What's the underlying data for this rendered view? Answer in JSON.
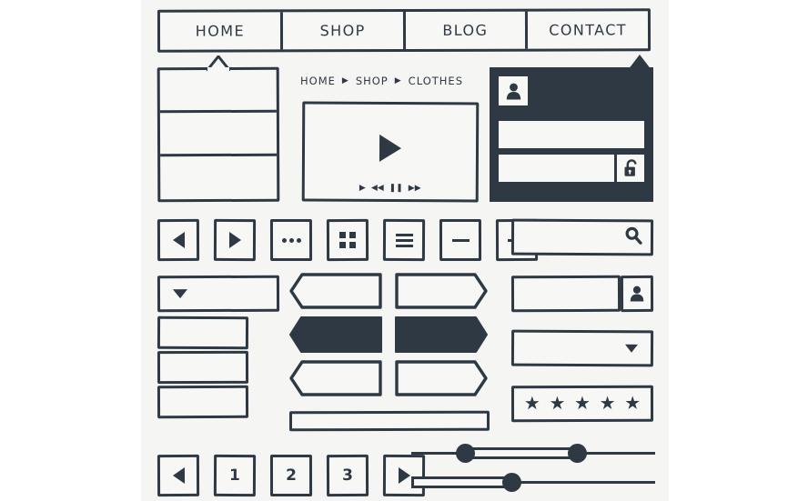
{
  "meta": {
    "title": "Hand-drawn UI Wireframe Element Kit",
    "colors": {
      "ink": "#2f3943",
      "paper": "#f7f7f6",
      "canvas": "#f5f5f4",
      "page": "#ffffff"
    }
  },
  "navbar": {
    "items": [
      {
        "label": "HOME"
      },
      {
        "label": "SHOP"
      },
      {
        "label": "BLOG"
      },
      {
        "label": "CONTACT"
      }
    ]
  },
  "tooltip_panel": {
    "name": "tooltip-accordion",
    "rows": [
      "",
      "",
      ""
    ],
    "notch_icon": "caret-up-notch"
  },
  "breadcrumb": {
    "items": [
      "HOME",
      "SHOP",
      "CLOTHES"
    ],
    "separator": "▶"
  },
  "video_player": {
    "play_icon": "play-triangle-icon",
    "controls": [
      {
        "icon": "play-icon",
        "glyph": "▶"
      },
      {
        "icon": "rewind-icon",
        "glyph": "◀◀"
      },
      {
        "icon": "pause-icon",
        "glyph": "❚❚"
      },
      {
        "icon": "fast-forward-icon",
        "glyph": "▶▶"
      }
    ]
  },
  "login_panel": {
    "avatar_icon": "user-icon",
    "username_value": "",
    "username_placeholder": "",
    "password_value": "",
    "password_placeholder": "",
    "lock_icon": "padlock-unlocked-icon",
    "notch_icon": "caret-up-notch"
  },
  "icon_buttons": [
    {
      "name": "prev-button",
      "icon": "triangle-left-icon"
    },
    {
      "name": "next-button",
      "icon": "triangle-right-icon"
    },
    {
      "name": "more-button",
      "icon": "ellipsis-icon"
    },
    {
      "name": "grid-view-button",
      "icon": "grid-icon"
    },
    {
      "name": "menu-button",
      "icon": "hamburger-icon"
    },
    {
      "name": "minus-button",
      "icon": "minus-icon"
    },
    {
      "name": "plus-button",
      "icon": "plus-icon"
    }
  ],
  "search": {
    "value": "",
    "placeholder": "",
    "icon": "search-icon"
  },
  "dropdown": {
    "trigger_label": "",
    "caret_icon": "caret-down-icon",
    "options": [
      "",
      "",
      ""
    ]
  },
  "chevron_banners": [
    {
      "name": "chevron-banner-notched-outline",
      "direction": "notched-left",
      "style": "outline",
      "label": ""
    },
    {
      "name": "chevron-banner-pointed-outline",
      "direction": "pointed-right",
      "style": "outline",
      "label": ""
    },
    {
      "name": "chevron-banner-notched-filled",
      "direction": "notched-left",
      "style": "filled",
      "label": ""
    },
    {
      "name": "chevron-banner-pointed-filled",
      "direction": "pointed-right",
      "style": "filled",
      "label": ""
    },
    {
      "name": "chevron-banner-notched-outline-2",
      "direction": "notched-left",
      "style": "outline",
      "label": ""
    },
    {
      "name": "chevron-banner-pointed-outline-2",
      "direction": "pointed-right",
      "style": "outline",
      "label": ""
    }
  ],
  "wide_bar": {
    "label": ""
  },
  "user_field": {
    "value": "",
    "placeholder": "",
    "button_icon": "user-icon"
  },
  "select_box": {
    "value": "",
    "caret_icon": "caret-down-icon"
  },
  "rating": {
    "icon": "star-icon",
    "glyph": "★",
    "count": 5,
    "filled": 5
  },
  "pagination": {
    "prev_icon": "triangle-left-icon",
    "next_icon": "triangle-right-icon",
    "pages": [
      "1",
      "2",
      "3"
    ]
  },
  "sliders": [
    {
      "name": "range-slider",
      "handles": 2,
      "left_percent": 22,
      "right_percent": 68
    },
    {
      "name": "value-slider",
      "handles": 1,
      "value_percent": 41
    }
  ]
}
